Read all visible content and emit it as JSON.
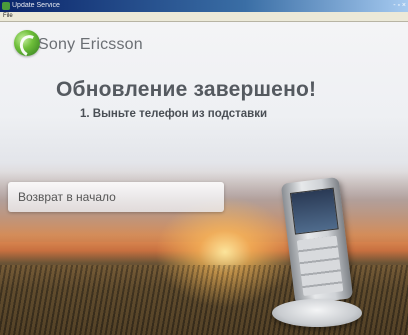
{
  "window": {
    "title": "Update Service",
    "controls": "- ▫ ×",
    "menu": "File"
  },
  "brand": {
    "name": "Sony Ericsson",
    "logo_icon": "sony-ericsson-logo-icon"
  },
  "main": {
    "headline": "Обновление завершено!",
    "instruction": "1. Выньте телефон из подставки",
    "back_button_label": "Возврат в начало"
  },
  "colors": {
    "headline": "#555a60",
    "logo_green": "#6fbf3a",
    "sunset": "#e2945a"
  }
}
